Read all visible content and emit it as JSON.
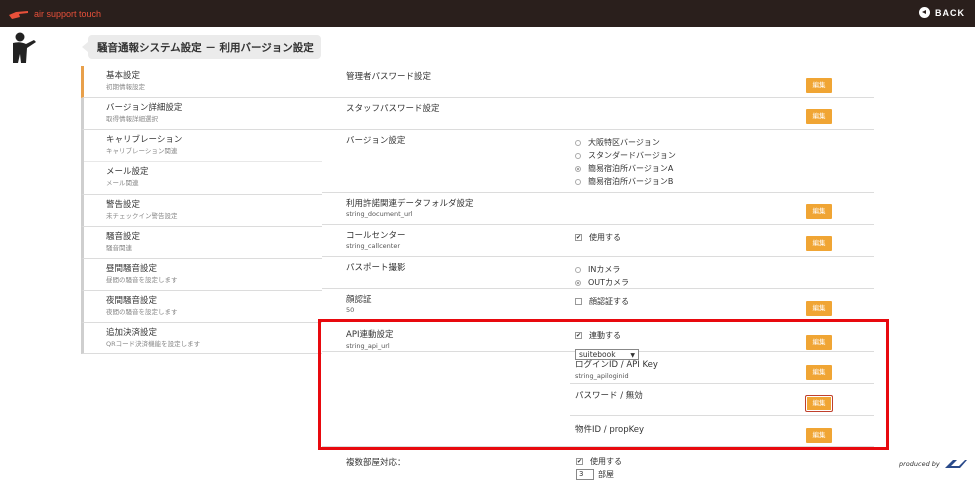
{
  "app": {
    "logo_text": "air support touch",
    "back_label": "BACK"
  },
  "page": {
    "title": "騒音通報システム設定 － 利用バージョン設定"
  },
  "sidebar": {
    "items": [
      {
        "title": "基本設定",
        "sub": "初期情報設定"
      },
      {
        "title": "バージョン詳細設定",
        "sub": "取得情報詳細選択"
      },
      {
        "title": "キャリブレーション",
        "sub": "キャリブレーション関連"
      },
      {
        "title": "メール設定",
        "sub": "メール関連"
      },
      {
        "title": "警告設定",
        "sub": "未チェックイン警告設定"
      },
      {
        "title": "騒音設定",
        "sub": "騒音関連"
      },
      {
        "title": "昼間騒音設定",
        "sub": "昼間の騒音を設定します"
      },
      {
        "title": "夜間騒音設定",
        "sub": "夜間の騒音を設定します"
      },
      {
        "title": "追加決済設定",
        "sub": "QRコード決済機能を設定します"
      }
    ]
  },
  "settings": {
    "edit_label": "編集",
    "admin_password": {
      "label": "管理者パスワード設定"
    },
    "staff_password": {
      "label": "スタッフパスワード設定"
    },
    "version": {
      "label": "バージョン設定",
      "options": [
        "大阪特区バージョン",
        "スタンダードバージョン",
        "簡易宿泊所バージョンA",
        "簡易宿泊所バージョンB"
      ],
      "selected_index": 2
    },
    "document_folder": {
      "label": "利用許諾関連データフォルダ設定",
      "sub": "string_document_url"
    },
    "call_center": {
      "label": "コールセンター",
      "sub": "string_callcenter",
      "option": "使用する",
      "checked": true
    },
    "passport": {
      "label": "パスポート撮影",
      "options": [
        "INカメラ",
        "OUTカメラ"
      ],
      "selected_index": 1
    },
    "face_auth": {
      "label": "顔認証",
      "sub": "50",
      "option": "顔認証する",
      "checked": false
    },
    "api": {
      "label": "API連動設定",
      "sub": "string_api_url",
      "option": "連動する",
      "checked": true,
      "select_value": "suitebook"
    },
    "api_login": {
      "label": "ログインID / API Key",
      "sub": "string_apiloginid"
    },
    "api_password": {
      "label": "パスワード / 無効"
    },
    "property_id": {
      "label": "物件ID / propKey"
    },
    "multi_room": {
      "label": "複数部屋対応：",
      "option": "使用する",
      "checked": true,
      "count_value": "3",
      "count_unit": "部屋"
    }
  },
  "footer": {
    "produced_by": "produced by"
  },
  "colors": {
    "accent": "#f0a534",
    "highlight": "#e8090e",
    "topbar": "#2a1f1c",
    "logo": "#e8503a"
  },
  "icons": {
    "logo": "pointing-hand-icon",
    "back": "back-arrow-icon",
    "avatar": "person-pointing-icon"
  }
}
